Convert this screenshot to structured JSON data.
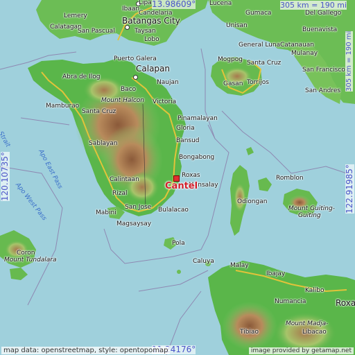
{
  "coords": {
    "top": "13.98609°",
    "bottom": "11.24176°",
    "left": "120.10735°",
    "right": "122.91985°"
  },
  "scale": {
    "h": "305 km = 190 mi",
    "v": "305 km = 190 mi"
  },
  "attribution": "map data: openstreetmap, style: opentopomap",
  "attribution_right": "image provided by getamap.net",
  "marker": {
    "label": "Cantel",
    "color": "#d21f2b"
  },
  "colors": {
    "sea": "#9fd0dc",
    "lowland": "#58b54c",
    "highland": "#a7794e",
    "coordinate_text": "#4a55c8"
  },
  "places": {
    "lipa": "Lipa",
    "lucena": "Lucena",
    "lemery": "Lemery",
    "ibaan": "Ibaan",
    "candelaria": "Candelaria",
    "batangas_city": "Batangas City",
    "taysan": "Taysan",
    "lobo": "Lobo",
    "calatagan": "Calatagan",
    "san_pascual": "San Pascual",
    "gumaca": "Gumaca",
    "del_gallego": "Del Gallego",
    "unisan": "Unisan",
    "mulanay_top": "Catanauan",
    "buenavista": "Buenavista",
    "general_luna": "General Luna",
    "mulanay": "Mulanay",
    "san_francisco": "San Francisco",
    "san_andres": "San Andres",
    "mogpog": "Mogpog",
    "santa_cruz_m": "Santa Cruz",
    "torrijos": "Torrijos",
    "gasan": "Gasan",
    "puerto_galera": "Puerto Galera",
    "abra_de_ilog": "Abra de Ilog",
    "calapan": "Calapan",
    "baco": "Baco",
    "naujan": "Naujan",
    "mount_halcon": "Mount Halcon",
    "mamburao": "Mamburao",
    "victoria": "Victoria",
    "santa_cruz": "Santa Cruz",
    "pinamalayan": "Pinamalayan",
    "gloria": "Gloria",
    "sablayan": "Sablayan",
    "bansud": "Bansud",
    "bongabong": "Bongabong",
    "roxas": "Roxas",
    "mansalay": "Mansalay",
    "calintaan": "Calintaan",
    "rizal": "Rizal",
    "san_jose": "San Jose",
    "bulalacao": "Bulalacao",
    "mabini": "Mabini",
    "magsaysay": "Magsaysay",
    "pola": "Pola",
    "romblon": "Romblon",
    "odiongan": "Odiongan",
    "mount_guiting": "Mount Guiting-",
    "guiting": "Guiting",
    "coron": "Coron",
    "mount_tundalara": "Mount Tundalara",
    "caluya": "Caluya",
    "malay": "Malay",
    "ibajay": "Ibajay",
    "kalibo": "Kalibo",
    "numancia": "Numancia",
    "roxas_capiz": "Roxas",
    "mount_madja": "Mount Madja-",
    "libacao": "Libacao",
    "tibiao": "Tibiao"
  },
  "water": {
    "apo_east_pass": "Apo East Pass",
    "apo_west_pass": "Apo West Pass",
    "strait": "Strait"
  }
}
